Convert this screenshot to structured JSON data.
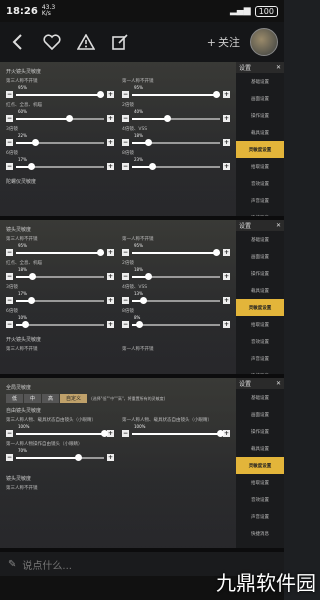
{
  "status": {
    "time": "18:26",
    "net": "43.3\nK/s",
    "battery": "100"
  },
  "topbar": {
    "follow_label": "关注"
  },
  "side_header": "设置",
  "side_items": [
    "基础设置",
    "画面设置",
    "操作设置",
    "载具设置",
    "灵敏度设置",
    "拾取设置",
    "音效设置",
    "声音设置",
    "快捷消息"
  ],
  "shot1": {
    "section": "开火镜头灵敏度",
    "rows": [
      {
        "left": {
          "label": "第三人称不开镜",
          "value": "95%"
        },
        "right": {
          "label": "第一人称不开镜",
          "value": "95%"
        }
      },
      {
        "left": {
          "label": "红点、全息、机瞄",
          "value": "60%"
        },
        "right": {
          "label": "2倍镜",
          "value": "40%"
        }
      },
      {
        "left": {
          "label": "3倍镜",
          "value": "22%"
        },
        "right": {
          "label": "4倍镜、VSS",
          "value": "18%"
        }
      },
      {
        "left": {
          "label": "6倍镜",
          "value": "17%"
        },
        "right": {
          "label": "8倍镜",
          "value": "23%"
        }
      }
    ],
    "footer": "陀螺仪灵敏度"
  },
  "shot2": {
    "section": "镜头灵敏度",
    "rows": [
      {
        "left": {
          "label": "第三人称不开镜",
          "value": "95%"
        },
        "right": {
          "label": "第一人称不开镜",
          "value": "95%"
        }
      },
      {
        "left": {
          "label": "红点、全息、机瞄",
          "value": "18%"
        },
        "right": {
          "label": "2倍镜",
          "value": "18%"
        }
      },
      {
        "left": {
          "label": "3倍镜",
          "value": "17%"
        },
        "right": {
          "label": "4倍镜、VSS",
          "value": "13%"
        }
      },
      {
        "left": {
          "label": "6倍镜",
          "value": "10%"
        },
        "right": {
          "label": "8倍镜",
          "value": "8%"
        }
      }
    ],
    "footer": "开火镜头灵敏度",
    "footer2a": "第三人称不开镜",
    "footer2b": "第一人称不开镜"
  },
  "shot3": {
    "section": "全局灵敏度",
    "segments": [
      "低",
      "中",
      "高",
      "自定义"
    ],
    "note": "(选择\"低\"\"中\"\"高\"，将重置所有的灵敏度)",
    "section2": "自由镜头灵敏度",
    "row1": {
      "left": {
        "label": "第三人称人物、载具状态自由镜头（小眼睛）",
        "value": "100%"
      },
      "right": {
        "label": "第一人称人物、载具状态自由镜头（小眼睛）",
        "value": "100%"
      }
    },
    "row2": {
      "left": {
        "label": "第一人称人物操作自由镜头（小眼睛）",
        "value": "70%"
      }
    },
    "section3": "镜头灵敏度",
    "footer": "第三人称不开镜"
  },
  "chat": {
    "placeholder": "说点什么..."
  },
  "watermark": "九鼎软件园"
}
